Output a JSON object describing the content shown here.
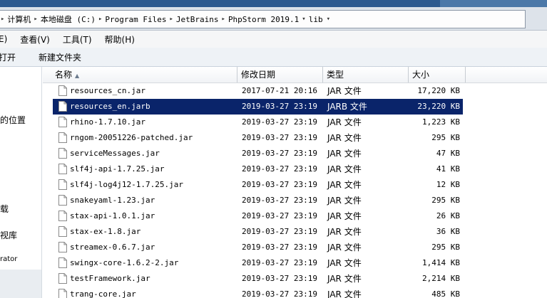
{
  "address": {
    "root_label": "计算机",
    "crumbs": [
      "本地磁盘 (C:)",
      "Program Files",
      "JetBrains",
      "PhpStorm 2019.1",
      "lib"
    ]
  },
  "menu": {
    "edit_fragment": "E)",
    "view": "查看(V)",
    "tools": "工具(T)",
    "help": "帮助(H)"
  },
  "toolbar": {
    "open_fragment": "打开",
    "new_folder": "新建文件夹"
  },
  "nav": {
    "recent_places_fragment": "的位置",
    "downloads_fragment": "载",
    "libraries_fragment": "视库",
    "user_fragment": "rator"
  },
  "columns": {
    "name": "名称",
    "date": "修改日期",
    "type": "类型",
    "size": "大小"
  },
  "files": [
    {
      "name": "resources_cn.jar",
      "date": "2017-07-21 20:16",
      "type": "JAR 文件",
      "size": "17,220 KB",
      "selected": false
    },
    {
      "name": "resources_en.jarb",
      "date": "2019-03-27 23:19",
      "type": "JARB 文件",
      "size": "23,220 KB",
      "selected": true
    },
    {
      "name": "rhino-1.7.10.jar",
      "date": "2019-03-27 23:19",
      "type": "JAR 文件",
      "size": "1,223 KB",
      "selected": false
    },
    {
      "name": "rngom-20051226-patched.jar",
      "date": "2019-03-27 23:19",
      "type": "JAR 文件",
      "size": "295 KB",
      "selected": false
    },
    {
      "name": "serviceMessages.jar",
      "date": "2019-03-27 23:19",
      "type": "JAR 文件",
      "size": "47 KB",
      "selected": false
    },
    {
      "name": "slf4j-api-1.7.25.jar",
      "date": "2019-03-27 23:19",
      "type": "JAR 文件",
      "size": "41 KB",
      "selected": false
    },
    {
      "name": "slf4j-log4j12-1.7.25.jar",
      "date": "2019-03-27 23:19",
      "type": "JAR 文件",
      "size": "12 KB",
      "selected": false
    },
    {
      "name": "snakeyaml-1.23.jar",
      "date": "2019-03-27 23:19",
      "type": "JAR 文件",
      "size": "295 KB",
      "selected": false
    },
    {
      "name": "stax-api-1.0.1.jar",
      "date": "2019-03-27 23:19",
      "type": "JAR 文件",
      "size": "26 KB",
      "selected": false
    },
    {
      "name": "stax-ex-1.8.jar",
      "date": "2019-03-27 23:19",
      "type": "JAR 文件",
      "size": "36 KB",
      "selected": false
    },
    {
      "name": "streamex-0.6.7.jar",
      "date": "2019-03-27 23:19",
      "type": "JAR 文件",
      "size": "295 KB",
      "selected": false
    },
    {
      "name": "swingx-core-1.6.2-2.jar",
      "date": "2019-03-27 23:19",
      "type": "JAR 文件",
      "size": "1,414 KB",
      "selected": false
    },
    {
      "name": "testFramework.jar",
      "date": "2019-03-27 23:19",
      "type": "JAR 文件",
      "size": "2,214 KB",
      "selected": false
    },
    {
      "name": "trang-core.jar",
      "date": "2019-03-27 23:19",
      "type": "JAR 文件",
      "size": "485 KB",
      "selected": false
    }
  ],
  "colors": {
    "selection": "#0a246a",
    "title_bar": "#2d5a8f"
  }
}
